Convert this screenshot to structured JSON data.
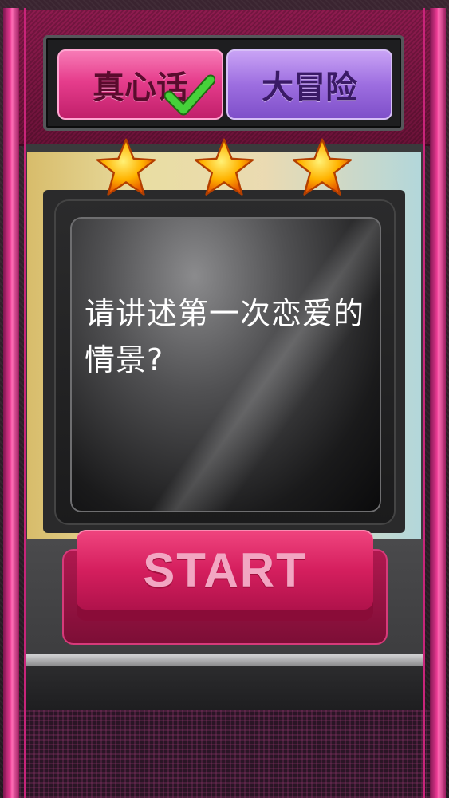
{
  "tabs": {
    "truth": {
      "label": "真心话",
      "selected": true
    },
    "dare": {
      "label": "大冒险",
      "selected": false
    }
  },
  "stars": {
    "count": 3
  },
  "question": {
    "text": "请讲述第一次恋爱的情景?"
  },
  "start_button": {
    "label": "START"
  },
  "icons": {
    "check": "check-icon",
    "star": "star-icon"
  },
  "colors": {
    "truth_tab": "#e63d8c",
    "dare_tab": "#9d6ee0",
    "start_button": "#d51f5e",
    "check": "#3ec92f",
    "star": "#ffb000"
  }
}
